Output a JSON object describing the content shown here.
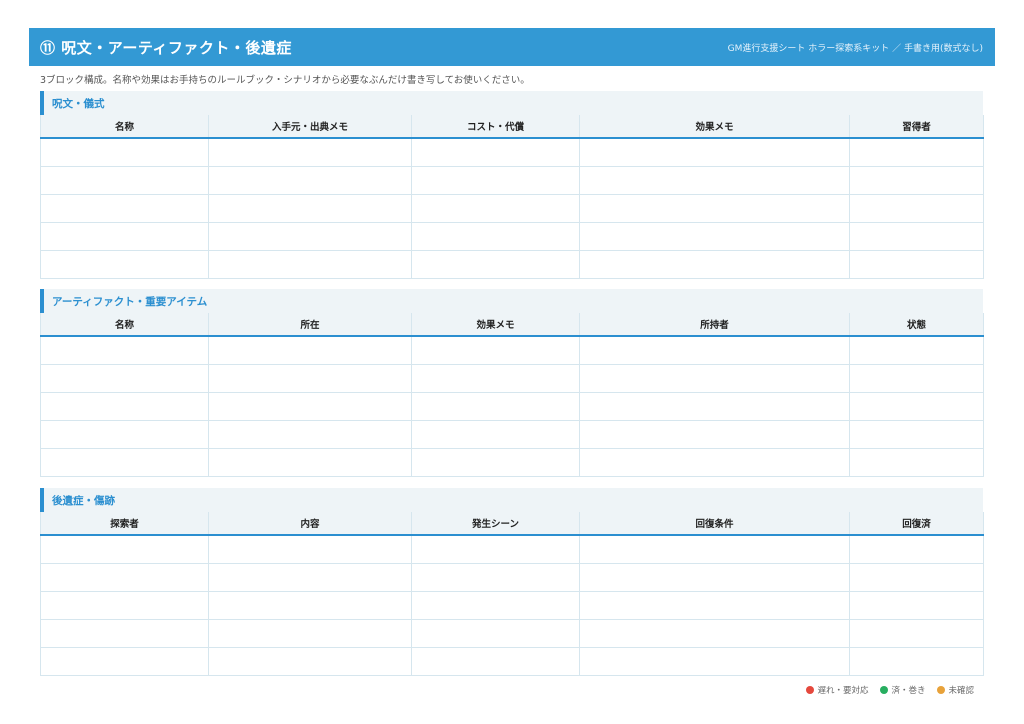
{
  "header": {
    "title": "⑪ 呪文・アーティファクト・後遺症",
    "subtitle": "GM進行支援シート ホラー探索系キット ／ 手書き用(数式なし)"
  },
  "intro": "3ブロック構成。名称や効果はお手持ちのルールブック・シナリオから必要なぶんだけ書き写してお使いください。",
  "sections": [
    {
      "title": "呪文・儀式",
      "columns": [
        "名称",
        "入手元・出典メモ",
        "コスト・代償",
        "効果メモ",
        "習得者"
      ],
      "blank_rows": 5
    },
    {
      "title": "アーティファクト・重要アイテム",
      "columns": [
        "名称",
        "所在",
        "効果メモ",
        "所持者",
        "状態"
      ],
      "blank_rows": 5
    },
    {
      "title": "後遺症・傷跡",
      "columns": [
        "探索者",
        "内容",
        "発生シーン",
        "回復条件",
        "回復済"
      ],
      "blank_rows": 5
    }
  ],
  "legend": [
    {
      "label": "遅れ・要対応",
      "color": "#e5483d"
    },
    {
      "label": "済・巻き",
      "color": "#27ae60"
    },
    {
      "label": "未確認",
      "color": "#e8a23a"
    }
  ]
}
